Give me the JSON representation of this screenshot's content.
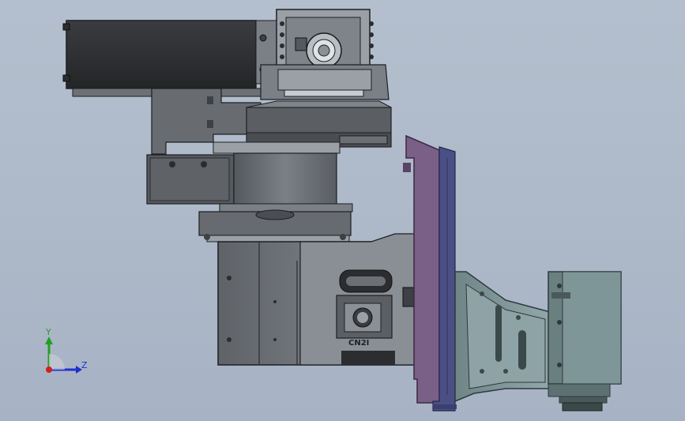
{
  "viewport": {
    "background_top": "#b4bfce",
    "background_bottom": "#a7b3c4"
  },
  "model": {
    "connector_label": "CN2I",
    "colors": {
      "dark_body": "#2e3033",
      "grey_body": "#6c7075",
      "light_grey": "#9aa0a6",
      "edge": "#1d1f22",
      "purple_plate": "#7a5f86",
      "blue_plate": "#4a4f86",
      "teal_bracket": "#7f9698",
      "teal_motor": "#6a7f80"
    }
  },
  "triad": {
    "y_label": "Y",
    "z_label": "Z",
    "y_color": "#22a022",
    "z_color": "#1e2fd0",
    "x_color": "#d02020"
  }
}
